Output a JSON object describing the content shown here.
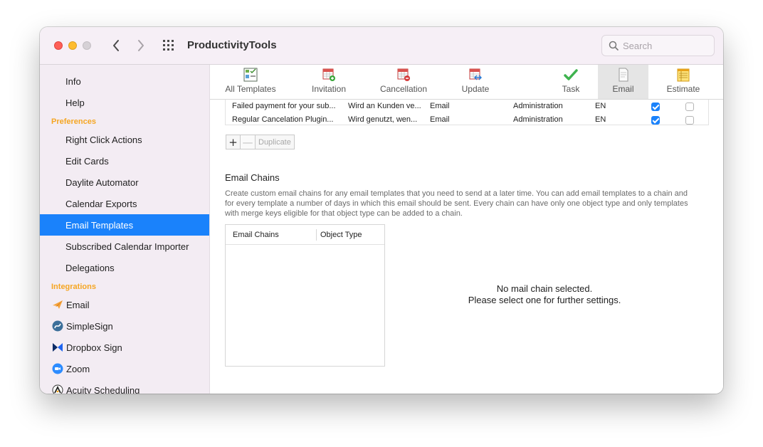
{
  "window": {
    "title": "ProductivityTools"
  },
  "search": {
    "placeholder": "Search"
  },
  "sidebar": {
    "top_items": [
      "Info",
      "Help"
    ],
    "preferences_label": "Preferences",
    "preferences": [
      "Right Click Actions",
      "Edit Cards",
      "Daylite Automator",
      "Calendar Exports",
      "Email Templates",
      "Subscribed Calendar Importer",
      "Delegations"
    ],
    "active_item": "Email Templates",
    "integrations_label": "Integrations",
    "integrations": [
      "Email",
      "SimpleSign",
      "Dropbox Sign",
      "Zoom",
      "Acuity Scheduling"
    ]
  },
  "toolbar": {
    "tabs": [
      "All Templates",
      "Invitation",
      "Cancellation",
      "Update",
      "Task",
      "Email",
      "Estimate"
    ],
    "active_tab": "Email"
  },
  "templates": {
    "rows": [
      {
        "name": "Failed payment for your sub...",
        "description": "Wird an Kunden ve...",
        "type": "Email",
        "category": "Administration",
        "language": "EN",
        "enabled": true,
        "default": false
      },
      {
        "name": "Regular Cancelation Plugin...",
        "description": "Wird genutzt, wen...",
        "type": "Email",
        "category": "Administration",
        "language": "EN",
        "enabled": true,
        "default": false
      }
    ],
    "add_label": "+",
    "remove_label": "—",
    "duplicate_label": "Duplicate"
  },
  "email_chains": {
    "title": "Email Chains",
    "description": "Create custom email chains for any email templates that you need to send at a later time. You can add email templates to a chain and for every template a number of days in which this email should be sent. Every chain can have only one object type and only templates with merge keys eligible for that object type can be added to a chain.",
    "columns": [
      "Email Chains",
      "Object Type"
    ],
    "add_label": "+",
    "remove_label": "—",
    "empty_line1": "No mail chain selected.",
    "empty_line2": "Please select one for further settings."
  },
  "colors": {
    "accent": "#1a82fb",
    "section": "#f5a623"
  }
}
